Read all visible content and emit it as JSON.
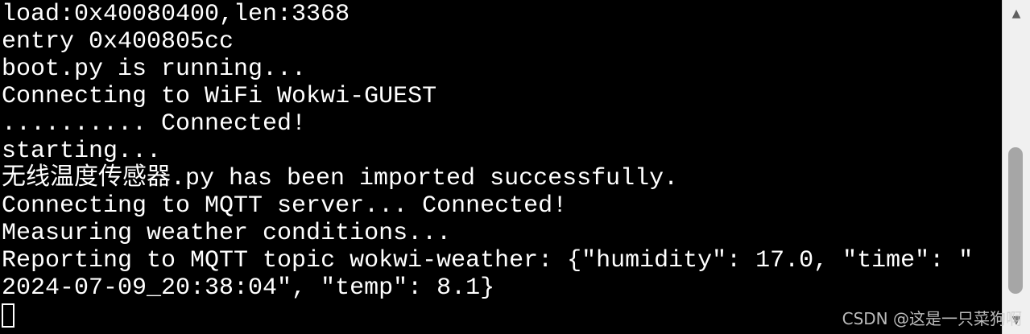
{
  "terminal": {
    "lines": [
      "load:0x40080400,len:3368",
      "entry 0x400805cc",
      "boot.py is running...",
      "Connecting to WiFi Wokwi-GUEST",
      ".......... Connected!",
      "starting...",
      "无线温度传感器.py has been imported successfully.",
      "Connecting to MQTT server... Connected!",
      "Measuring weather conditions...",
      "Reporting to MQTT topic wokwi-weather: {\"humidity\": 17.0, \"time\": \"",
      "2024-07-09_20:38:04\", \"temp\": 8.1}"
    ]
  },
  "scrollbar": {
    "up_icon": "▲",
    "down_icon": "▼"
  },
  "watermark": {
    "text": "CSDN @这是一只菜狗啊"
  },
  "colors": {
    "background": "#000000",
    "text": "#ffffff",
    "scrollbar_track": "#f0f0f0",
    "scrollbar_thumb": "#a6a6a6"
  }
}
